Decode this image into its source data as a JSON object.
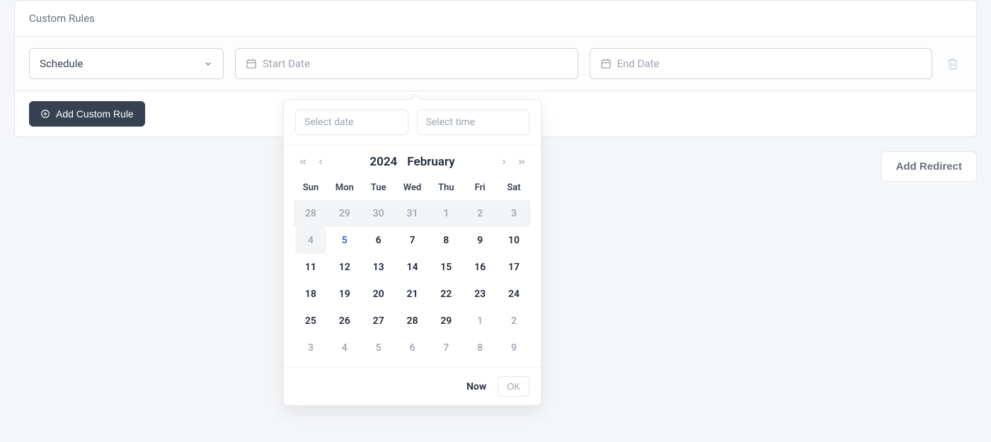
{
  "panel": {
    "title": "Custom Rules",
    "rule_type": "Schedule",
    "start_placeholder": "Start Date",
    "end_placeholder": "End Date",
    "add_rule_label": "Add Custom Rule"
  },
  "actions": {
    "add_redirect": "Add Redirect"
  },
  "datepicker": {
    "date_placeholder": "Select date",
    "time_placeholder": "Select time",
    "year": "2024",
    "month": "February",
    "weekdays": [
      "Sun",
      "Mon",
      "Tue",
      "Wed",
      "Thu",
      "Fri",
      "Sat"
    ],
    "rows": [
      {
        "bg": true,
        "cells": [
          {
            "d": "28",
            "muted": true
          },
          {
            "d": "29",
            "muted": true
          },
          {
            "d": "30",
            "muted": true
          },
          {
            "d": "31",
            "muted": true
          },
          {
            "d": "1"
          },
          {
            "d": "2"
          },
          {
            "d": "3"
          }
        ]
      },
      {
        "cells": [
          {
            "d": "4",
            "hovered": true,
            "muted": true
          },
          {
            "d": "5",
            "today": true
          },
          {
            "d": "6"
          },
          {
            "d": "7"
          },
          {
            "d": "8"
          },
          {
            "d": "9"
          },
          {
            "d": "10"
          }
        ]
      },
      {
        "cells": [
          {
            "d": "11"
          },
          {
            "d": "12"
          },
          {
            "d": "13"
          },
          {
            "d": "14"
          },
          {
            "d": "15"
          },
          {
            "d": "16"
          },
          {
            "d": "17"
          }
        ]
      },
      {
        "cells": [
          {
            "d": "18"
          },
          {
            "d": "19"
          },
          {
            "d": "20"
          },
          {
            "d": "21"
          },
          {
            "d": "22"
          },
          {
            "d": "23"
          },
          {
            "d": "24"
          }
        ]
      },
      {
        "cells": [
          {
            "d": "25"
          },
          {
            "d": "26"
          },
          {
            "d": "27"
          },
          {
            "d": "28"
          },
          {
            "d": "29"
          },
          {
            "d": "1",
            "muted": true
          },
          {
            "d": "2",
            "muted": true
          }
        ]
      },
      {
        "cells": [
          {
            "d": "3",
            "muted": true
          },
          {
            "d": "4",
            "muted": true
          },
          {
            "d": "5",
            "muted": true
          },
          {
            "d": "6",
            "muted": true
          },
          {
            "d": "7",
            "muted": true
          },
          {
            "d": "8",
            "muted": true
          },
          {
            "d": "9",
            "muted": true
          }
        ]
      }
    ],
    "now_label": "Now",
    "ok_label": "OK"
  }
}
